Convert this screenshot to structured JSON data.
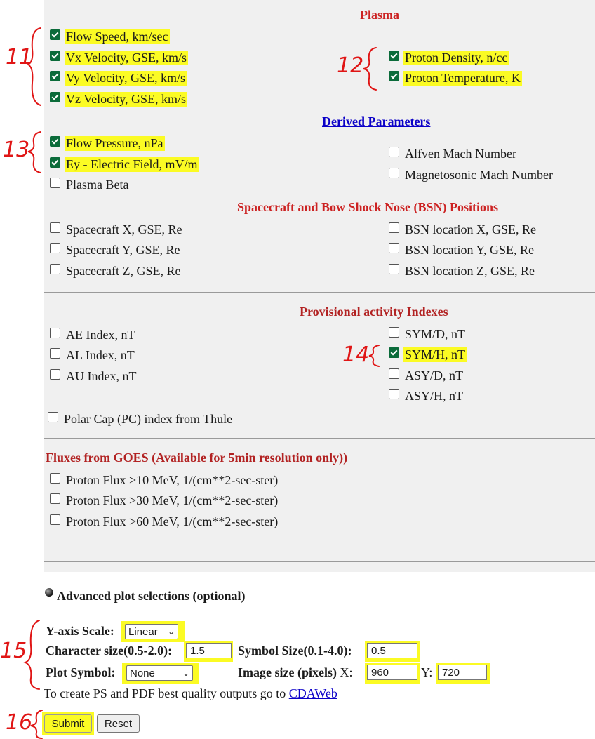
{
  "plasma": {
    "header": "Plasma",
    "left": [
      {
        "label": "Flow Speed, km/sec",
        "checked": true,
        "highlight": true
      },
      {
        "label": "Vx Velocity, GSE, km/s",
        "checked": true,
        "highlight": true
      },
      {
        "label": "Vy Velocity, GSE, km/s",
        "checked": true,
        "highlight": true
      },
      {
        "label": "Vz Velocity, GSE, km/s",
        "checked": true,
        "highlight": true
      }
    ],
    "right": [
      {
        "label": "Proton Density, n/cc",
        "checked": true,
        "highlight": true
      },
      {
        "label": "Proton Temperature, K",
        "checked": true,
        "highlight": true
      }
    ]
  },
  "derived": {
    "header": "Derived Parameters",
    "left": [
      {
        "label": "Flow Pressure, nPa",
        "checked": true,
        "highlight": true
      },
      {
        "label": "Ey - Electric Field, mV/m",
        "checked": true,
        "highlight": true
      },
      {
        "label": "Plasma Beta",
        "checked": false,
        "highlight": false
      }
    ],
    "right": [
      {
        "label": "Alfven Mach Number",
        "checked": false,
        "highlight": false
      },
      {
        "label": "Magnetosonic Mach Number",
        "checked": false,
        "highlight": false
      }
    ]
  },
  "positions": {
    "header": "Spacecraft and Bow Shock Nose (BSN) Positions",
    "left": [
      {
        "label": "Spacecraft X, GSE, Re",
        "checked": false
      },
      {
        "label": "Spacecraft Y, GSE, Re",
        "checked": false
      },
      {
        "label": "Spacecraft Z, GSE, Re",
        "checked": false
      }
    ],
    "right": [
      {
        "label": "BSN location X, GSE, Re",
        "checked": false
      },
      {
        "label": "BSN location Y, GSE, Re",
        "checked": false
      },
      {
        "label": "BSN location Z, GSE, Re",
        "checked": false
      }
    ]
  },
  "indexes": {
    "header": "Provisional activity Indexes",
    "left": [
      {
        "label": "AE Index, nT",
        "checked": false
      },
      {
        "label": "AL Index, nT",
        "checked": false
      },
      {
        "label": "AU Index, nT",
        "checked": false
      }
    ],
    "right": [
      {
        "label": "SYM/D, nT",
        "checked": false,
        "highlight": false
      },
      {
        "label": "SYM/H, nT",
        "checked": true,
        "highlight": true
      },
      {
        "label": "ASY/D, nT",
        "checked": false,
        "highlight": false
      },
      {
        "label": "ASY/H, nT",
        "checked": false,
        "highlight": false
      }
    ],
    "polar": {
      "label": "Polar Cap (PC) index from Thule",
      "checked": false
    }
  },
  "goes": {
    "header": "Fluxes from GOES (Available for 5min resolution only))",
    "items": [
      {
        "label": "Proton Flux >10 MeV, 1/(cm**2-sec-ster)",
        "checked": false
      },
      {
        "label": "Proton Flux >30 MeV, 1/(cm**2-sec-ster)",
        "checked": false
      },
      {
        "label": "Proton Flux >60 MeV, 1/(cm**2-sec-ster)",
        "checked": false
      }
    ]
  },
  "advanced": {
    "title": "Advanced plot selections (optional)",
    "yaxis_label": "Y-axis Scale:",
    "yaxis_value": "Linear",
    "charsize_label": "Character size(0.5-2.0):",
    "charsize_value": "1.5",
    "symsize_label": "Symbol Size(0.1-4.0):",
    "symsize_value": "0.5",
    "plotsym_label": "Plot Symbol:",
    "plotsym_value": "None",
    "imgsize_label": "Image size (pixels)",
    "x_label": "X:",
    "x_value": "960",
    "y_label": "Y:",
    "y_value": "720",
    "cda_text": "To create PS and PDF best quality outputs go to",
    "cda_link": "CDAWeb"
  },
  "buttons": {
    "submit": "Submit",
    "reset": "Reset"
  },
  "annotations": [
    "11",
    "12",
    "13",
    "14",
    "15",
    "16"
  ],
  "colors": {
    "highlight": "#fbfb24",
    "header_red": "#cc2222",
    "link_blue": "#0b00c8",
    "annotation_red": "#e01515"
  }
}
